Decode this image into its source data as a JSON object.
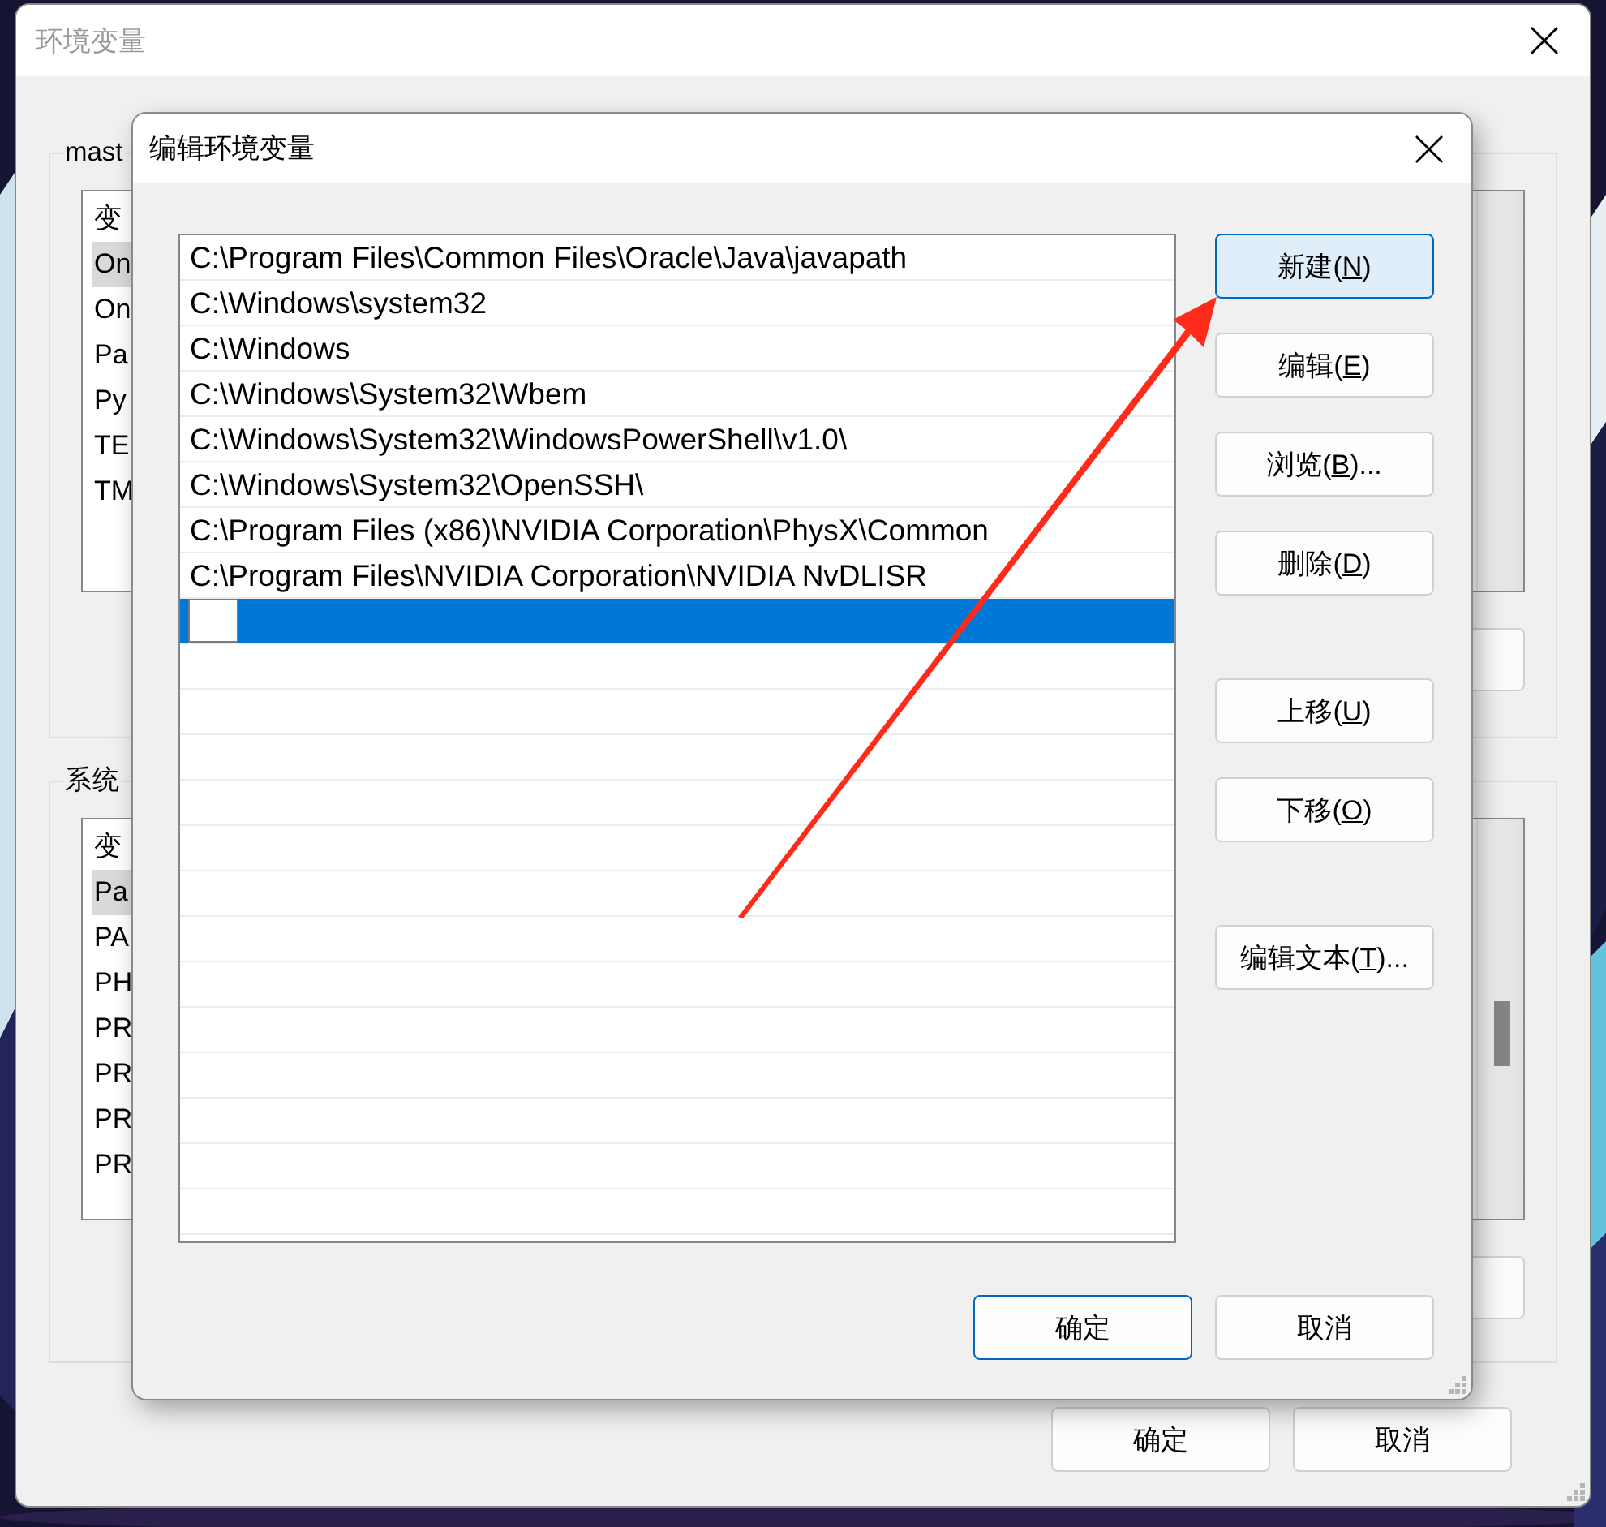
{
  "window": {
    "title": "环境变量",
    "active": false
  },
  "user_variables": {
    "group_label": "mast",
    "header": "变",
    "rows": [
      {
        "name": "On",
        "selected": true
      },
      {
        "name": "On",
        "selected": false
      },
      {
        "name": "Pa",
        "selected": false
      },
      {
        "name": "Py",
        "selected": false
      },
      {
        "name": "TE",
        "selected": false
      },
      {
        "name": "TM",
        "selected": false
      }
    ]
  },
  "system_variables": {
    "group_label": "系统",
    "header": "变",
    "rows": [
      {
        "name": "Pa",
        "selected": true
      },
      {
        "name": "PA",
        "selected": false
      },
      {
        "name": "PH",
        "selected": false
      },
      {
        "name": "PR",
        "selected": false
      },
      {
        "name": "PR",
        "selected": false
      },
      {
        "name": "PR",
        "selected": false
      },
      {
        "name": "PR",
        "selected": false
      }
    ]
  },
  "buttons": [
    {
      "label": "确定"
    },
    {
      "label": "取消"
    }
  ],
  "dialog": {
    "title": "编辑环境变量",
    "paths": [
      {
        "text": "C:\\Program Files\\Common Files\\Oracle\\Java\\javapath",
        "selected": false,
        "editing": false
      },
      {
        "text": "C:\\Windows\\system32",
        "selected": false,
        "editing": false
      },
      {
        "text": "C:\\Windows",
        "selected": false,
        "editing": false
      },
      {
        "text": "C:\\Windows\\System32\\Wbem",
        "selected": false,
        "editing": false
      },
      {
        "text": "C:\\Windows\\System32\\WindowsPowerShell\\v1.0\\",
        "selected": false,
        "editing": false
      },
      {
        "text": "C:\\Windows\\System32\\OpenSSH\\",
        "selected": false,
        "editing": false
      },
      {
        "text": "C:\\Program Files (x86)\\NVIDIA Corporation\\PhysX\\Common",
        "selected": false,
        "editing": false
      },
      {
        "text": "C:\\Program Files\\NVIDIA Corporation\\NVIDIA NvDLISR",
        "selected": false,
        "editing": false
      },
      {
        "selected": true,
        "editing": true
      }
    ],
    "button_groups": [
      [
        {
          "before": "新建(",
          "key": "N",
          "after": ")",
          "focused": true
        },
        {
          "before": "编辑(",
          "key": "E",
          "after": ")",
          "focused": false
        },
        {
          "before": "浏览(",
          "key": "B",
          "after": ")...",
          "focused": false
        },
        {
          "before": "删除(",
          "key": "D",
          "after": ")",
          "focused": false
        }
      ],
      [
        {
          "before": "上移(",
          "key": "U",
          "after": ")",
          "focused": false
        },
        {
          "before": "下移(",
          "key": "O",
          "after": ")",
          "focused": false
        }
      ],
      [
        {
          "before": "编辑文本(",
          "key": "T",
          "after": ")...",
          "focused": false
        }
      ]
    ],
    "footer_buttons": [
      {
        "label": "确定",
        "default": true
      },
      {
        "label": "取消",
        "default": false
      }
    ]
  }
}
